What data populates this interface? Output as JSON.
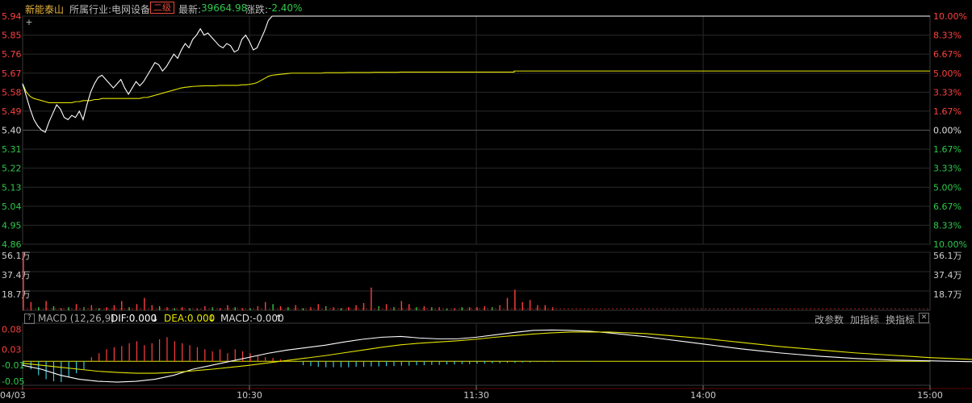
{
  "header": {
    "stock_name": "新能泰山",
    "industry_label": "所属行业:",
    "industry_name": "电网设备",
    "level_badge": "二级",
    "latest_label": "最新:",
    "latest_value": "39664.98",
    "change_label": "涨跌:",
    "change_value": "-2.40%"
  },
  "macd_bar": {
    "help": "?",
    "title": "MACD (12,26,9)",
    "dif": "DIF:0.000",
    "dif_arrow": "↓",
    "dea": "DEA:0.000",
    "dea_arrow": "↓",
    "macd": "MACD:-0.000",
    "macd_arrow": "↑",
    "btn_params": "改参数",
    "btn_add": "加指标",
    "btn_switch": "换指标",
    "btn_close": "✕"
  },
  "colors": {
    "up": "#ff4040",
    "down": "#2ec94a",
    "flat": "#dddddd",
    "price_line": "#ffffff",
    "avg_line": "#e6e600",
    "macd_neg": "#39c8d8",
    "grid": "#2a2a2a",
    "axis": "#5a0000"
  },
  "chart_data": [
    {
      "type": "line",
      "name": "price-panel",
      "x_ticks": [
        "04/03",
        "10:30",
        "11:30",
        "14:00",
        "15:00"
      ],
      "y_ticks_left": [
        "5.94",
        "5.85",
        "5.76",
        "5.67",
        "5.58",
        "5.49",
        "5.40",
        "5.31",
        "5.22",
        "5.13",
        "5.04",
        "4.95",
        "4.86"
      ],
      "y_ticks_right": [
        "10.00%",
        "8.33%",
        "6.67%",
        "5.00%",
        "3.33%",
        "1.67%",
        "0.00%",
        "1.67%",
        "3.33%",
        "5.00%",
        "6.67%",
        "8.33%",
        "10.00%"
      ],
      "ylim": [
        4.86,
        5.94
      ],
      "base": 5.4,
      "series": [
        {
          "values": [
            5.62,
            5.56,
            5.5,
            5.45,
            5.42,
            5.4,
            5.39,
            5.44,
            5.48,
            5.52,
            5.5,
            5.46,
            5.45,
            5.47,
            5.46,
            5.49,
            5.45,
            5.52,
            5.58,
            5.62,
            5.65,
            5.66,
            5.64,
            5.62,
            5.6,
            5.62,
            5.64,
            5.6,
            5.57,
            5.6,
            5.63,
            5.61,
            5.63,
            5.66,
            5.69,
            5.72,
            5.71,
            5.68,
            5.7,
            5.73,
            5.76,
            5.74,
            5.78,
            5.81,
            5.79,
            5.83,
            5.85,
            5.88,
            5.85,
            5.86,
            5.84,
            5.82,
            5.8,
            5.79,
            5.81,
            5.8,
            5.77,
            5.78,
            5.83,
            5.85,
            5.82,
            5.78,
            5.79,
            5.83,
            5.87,
            5.92,
            5.94
          ],
          "fill_to": 240,
          "fill_value": 5.94
        },
        {
          "values": [
            5.62,
            5.58,
            5.56,
            5.55,
            5.545,
            5.54,
            5.535,
            5.53,
            5.53,
            5.53,
            5.53,
            5.53,
            5.53,
            5.53,
            5.535,
            5.535,
            5.54,
            5.54,
            5.54,
            5.545,
            5.545,
            5.55,
            5.55,
            5.55,
            5.55,
            5.55,
            5.55,
            5.55,
            5.55,
            5.55,
            5.55,
            5.55,
            5.555,
            5.555,
            5.56,
            5.565,
            5.57,
            5.575,
            5.58,
            5.585,
            5.59,
            5.595,
            5.6,
            5.603,
            5.605,
            5.607,
            5.608,
            5.609,
            5.61,
            5.61,
            5.61,
            5.61,
            5.612,
            5.612,
            5.612,
            5.612,
            5.612,
            5.612,
            5.615,
            5.615,
            5.617,
            5.62,
            5.625,
            5.635,
            5.645,
            5.655,
            5.66,
            5.662,
            5.664,
            5.666,
            5.668,
            5.67,
            5.67,
            5.67,
            5.67,
            5.67,
            5.67,
            5.67,
            5.67,
            5.67,
            5.672,
            5.672,
            5.672,
            5.672,
            5.672,
            5.672,
            5.673,
            5.673,
            5.673,
            5.673,
            5.673,
            5.673,
            5.673,
            5.674,
            5.674,
            5.674,
            5.674,
            5.674,
            5.674,
            5.674,
            5.675
          ],
          "fill_to": 240,
          "fill_value": 5.675,
          "step_at": 130,
          "step_value": 5.68
        }
      ]
    },
    {
      "type": "bar",
      "name": "volume-panel",
      "unit": "万",
      "y_ticks": [
        "56.1万",
        "37.4万",
        "18.7万"
      ],
      "ylim": [
        0,
        56.1
      ],
      "values": [
        56.1,
        8,
        3,
        9,
        4,
        2,
        3,
        6,
        3,
        5,
        2,
        3,
        5,
        9,
        3,
        6,
        12,
        5,
        4,
        3,
        2,
        3,
        2,
        2,
        4,
        3,
        2,
        5,
        3,
        2,
        2,
        4,
        8,
        6,
        4,
        3,
        5,
        2,
        3,
        6,
        4,
        3,
        2,
        3,
        5,
        7,
        22,
        4,
        6,
        3,
        9,
        6,
        3,
        4,
        3,
        3,
        2,
        2,
        3,
        3,
        3,
        4,
        3,
        5,
        12,
        20,
        8,
        10,
        5,
        5,
        3
      ],
      "colors": [
        "up",
        "up",
        "down",
        "up",
        "down",
        "up",
        "down",
        "up",
        "down",
        "up",
        "down",
        "up",
        "up",
        "up",
        "down",
        "up",
        "up",
        "up",
        "down",
        "up",
        "down",
        "up",
        "down",
        "up",
        "up",
        "down",
        "up",
        "up",
        "down",
        "up",
        "down",
        "up",
        "up",
        "down",
        "up",
        "down",
        "up",
        "down",
        "up",
        "up",
        "down",
        "up",
        "down",
        "up",
        "up",
        "up",
        "up",
        "down",
        "up",
        "down",
        "up",
        "up",
        "down",
        "up",
        "down",
        "up",
        "down",
        "up",
        "down",
        "up",
        "up",
        "up",
        "down",
        "up",
        "up",
        "up",
        "up",
        "up",
        "up",
        "up",
        "up"
      ]
    },
    {
      "type": "line",
      "name": "macd-panel",
      "y_ticks": [
        "0.08",
        "0.03",
        "-0.01",
        "-0.05"
      ],
      "ylim": [
        -0.06,
        0.095
      ],
      "series": [
        {
          "values": [
            -0.01,
            -0.02,
            -0.035,
            -0.045,
            -0.05,
            -0.052,
            -0.05,
            -0.045,
            -0.035,
            -0.02,
            -0.01,
            0.0,
            0.01,
            0.02,
            0.028,
            0.034,
            0.04,
            0.048,
            0.055,
            0.06,
            0.062,
            0.058,
            0.056,
            0.056,
            0.06,
            0.066,
            0.072,
            0.077,
            0.078,
            0.077,
            0.075,
            0.071,
            0.066,
            0.061,
            0.055,
            0.049,
            0.043,
            0.037,
            0.031,
            0.026,
            0.021,
            0.017,
            0.013,
            0.01,
            0.007,
            0.005,
            0.003,
            0.002,
            0.001,
            0.0,
            -0.001,
            -0.001,
            -0.001,
            -0.001,
            -0.001
          ]
        },
        {
          "values": [
            -0.005,
            -0.01,
            -0.015,
            -0.02,
            -0.025,
            -0.028,
            -0.03,
            -0.03,
            -0.028,
            -0.024,
            -0.02,
            -0.015,
            -0.01,
            -0.004,
            0.002,
            0.008,
            0.014,
            0.021,
            0.028,
            0.035,
            0.041,
            0.045,
            0.048,
            0.051,
            0.055,
            0.06,
            0.064,
            0.068,
            0.071,
            0.073,
            0.073,
            0.073,
            0.071,
            0.069,
            0.065,
            0.061,
            0.057,
            0.052,
            0.047,
            0.042,
            0.037,
            0.033,
            0.029,
            0.025,
            0.021,
            0.018,
            0.015,
            0.012,
            0.009,
            0.007,
            0.005,
            0.003,
            0.002,
            0.001,
            0.0
          ]
        }
      ],
      "histogram": [
        -0.01,
        -0.02,
        -0.035,
        -0.045,
        -0.05,
        -0.052,
        -0.04,
        -0.03,
        -0.02,
        0.01,
        0.02,
        0.03,
        0.035,
        0.038,
        0.045,
        0.05,
        0.04,
        0.045,
        0.055,
        0.06,
        0.05,
        0.045,
        0.04,
        0.035,
        0.03,
        0.025,
        0.03,
        0.02,
        0.03,
        0.025,
        0.02,
        0.015,
        0.01,
        0.008,
        0.005,
        0.002,
        -0.002,
        -0.01,
        -0.012,
        -0.014,
        -0.015,
        -0.015,
        -0.015,
        -0.015,
        -0.014,
        -0.014,
        -0.013,
        -0.013,
        -0.012,
        -0.012,
        -0.011,
        -0.011,
        -0.01,
        -0.01,
        -0.009,
        -0.009,
        -0.008,
        -0.008,
        -0.007,
        -0.007,
        -0.006,
        -0.006,
        -0.005,
        -0.005,
        -0.004,
        -0.004,
        -0.003,
        -0.003,
        -0.002,
        -0.002,
        -0.002,
        -0.001,
        -0.001,
        -0.001,
        -0.001,
        -0.001
      ]
    }
  ]
}
